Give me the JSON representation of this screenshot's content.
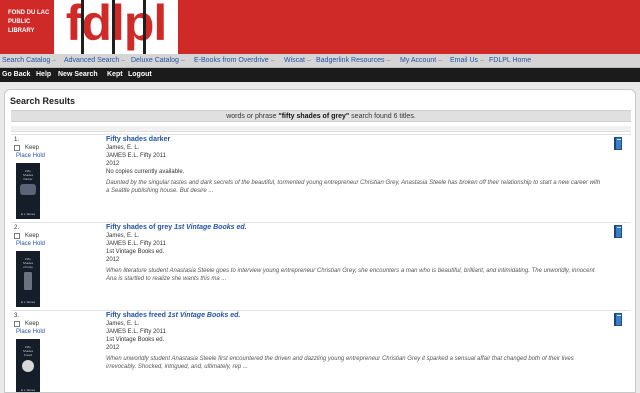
{
  "library": {
    "name_lines": [
      "FOND DU LAC",
      "PUBLIC",
      "LIBRARY"
    ],
    "logo": "fdlpl"
  },
  "nav": [
    "Search Catalog",
    "Advanced Search",
    "Deluxe Catalog",
    "E-Books from Overdrive",
    "Wiscat",
    "Badgerlink Resources",
    "My Account",
    "Email Us",
    "FDLPL Home"
  ],
  "nav_separator": "–",
  "toolbar": [
    "Go Back",
    "Help",
    "New Search",
    "Kept",
    "Logout"
  ],
  "page_title": "Search Results",
  "summary": {
    "prefix": "words or phrase",
    "query": "\"fifty shades of grey\"",
    "suffix": "search found 6 titles."
  },
  "results": [
    {
      "num": "1.",
      "keep": "Keep",
      "hold": "Place Hold",
      "cover": {
        "line1": "Fifty",
        "line2": "Shades",
        "line3": "Darker",
        "author": "E L James"
      },
      "title": "Fifty shades darker",
      "edition": "",
      "author": "James, E. L.",
      "call": "JAMES E.L. Fifty 2011",
      "year": "2012",
      "extra": "No copies currently available.",
      "desc": "Daunted by the singular tastes and dark secrets of the beautiful, tormented young entrepreneur Christian Grey, Anastasia Steele has broken off their relationship to start a new career with a Seattle publishing house.    But desire ..."
    },
    {
      "num": "2.",
      "keep": "Keep",
      "hold": "Place Hold",
      "cover": {
        "line1": "Fifty",
        "line2": "Shades",
        "line3": "of Grey",
        "author": "E L James"
      },
      "title": "Fifty shades of grey",
      "edition": "1st Vintage Books ed.",
      "author": "James, E. L.",
      "call": "JAMES E.L. Fifty 2011",
      "year": "1st Vintage Books ed.",
      "extra": "2012",
      "desc": "When literature student Anastasia Steele goes to interview young entrepreneur Christian Grey, she encounters a man who is beautiful, brilliant, and intimidating. The unworldly, innocent Ana is startled to realize she wants this ma ..."
    },
    {
      "num": "3.",
      "keep": "Keep",
      "hold": "Place Hold",
      "cover": {
        "line1": "Fifty",
        "line2": "Shades",
        "line3": "Freed",
        "author": "E L James"
      },
      "title": "Fifty shades freed",
      "edition": "1st Vintage Books ed.",
      "author": "James, E. L.",
      "call": "JAMES E.L. Fifty 2011",
      "year": "1st Vintage Books ed.",
      "extra": "2012",
      "desc": "When unworldly student Anastasia Steele first encountered the driven and dazzling young entrepreneur Christian Grey it sparked a sensual affair that changed both of their lives irrevocably. Shocked, intrigued, and, ultimately, rep ..."
    }
  ]
}
